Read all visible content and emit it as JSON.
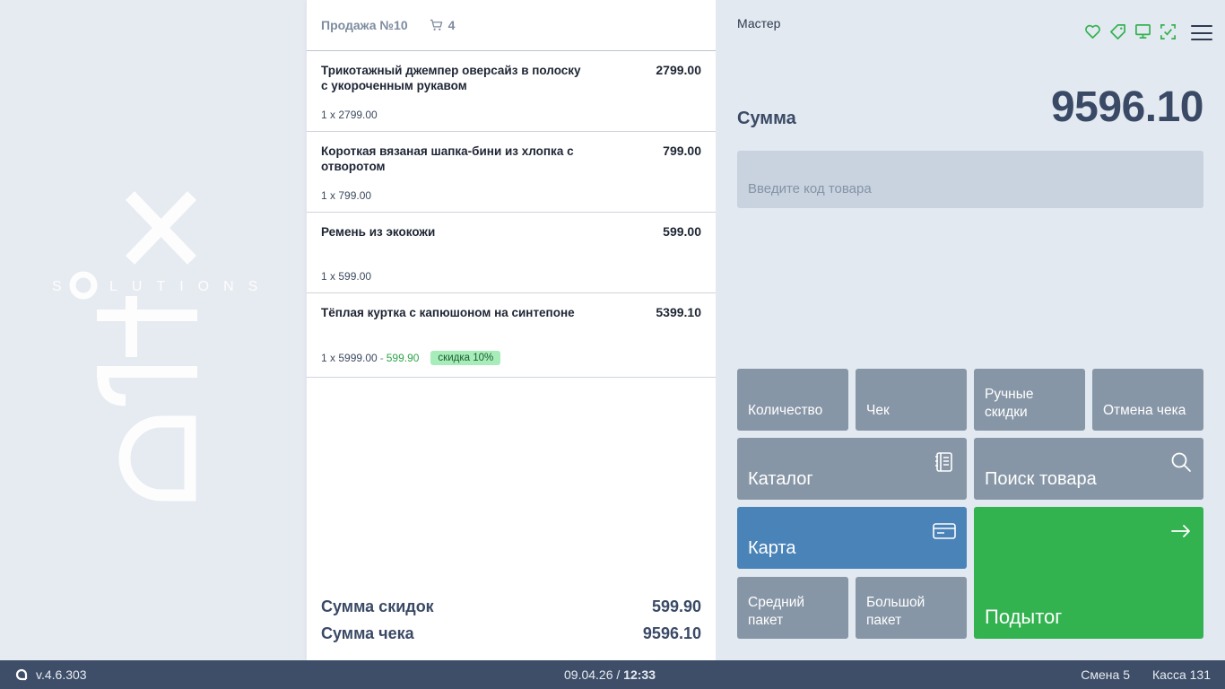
{
  "brand": {
    "logo_text": "artx",
    "logo_sub": "SOLUTIONS"
  },
  "receipt": {
    "title": "Продажа №10",
    "cart_count": "4",
    "items": [
      {
        "name": "Трикотажный джемпер оверсайз в полоску с укороченным рукавом",
        "price": "2799.00",
        "qty": "1 x 2799.00"
      },
      {
        "name": "Короткая вязаная шапка-бини из хлопка с отворотом",
        "price": "799.00",
        "qty": "1 x 799.00"
      },
      {
        "name": "Ремень из экокожи",
        "price": "599.00",
        "qty": "1 x 599.00"
      },
      {
        "name": "Тёплая куртка с капюшоном на синтепоне",
        "price": "5399.10",
        "qty": "1 x 5999.00",
        "discount_sep": "-",
        "discount": "599.90",
        "badge": "скидка 10%"
      }
    ],
    "discount_total_label": "Сумма скидок",
    "discount_total": "599.90",
    "check_total_label": "Сумма чека",
    "check_total": "9596.10"
  },
  "right": {
    "user": "Мастер",
    "sum_label": "Сумма",
    "sum_value": "9596.10",
    "code_placeholder": "Введите код товара",
    "buttons": {
      "quantity": "Количество",
      "check": "Чек",
      "manual_discounts": "Ручные скидки",
      "cancel_check": "Отмена чека",
      "catalog": "Каталог",
      "search": "Поиск товара",
      "card": "Карта",
      "medium_bag": "Средний пакет",
      "big_bag": "Большой пакет",
      "subtotal": "Подытог"
    }
  },
  "status": {
    "version": "v.4.6.303",
    "date": "09.04.26",
    "sep": "/",
    "time": "12:33",
    "shift": "Смена 5",
    "register": "Касса 131"
  },
  "colors": {
    "accent_green": "#33b250",
    "card_blue": "#4a83b8",
    "button_grey": "#8796a6",
    "statusbar": "#3f4e68"
  }
}
